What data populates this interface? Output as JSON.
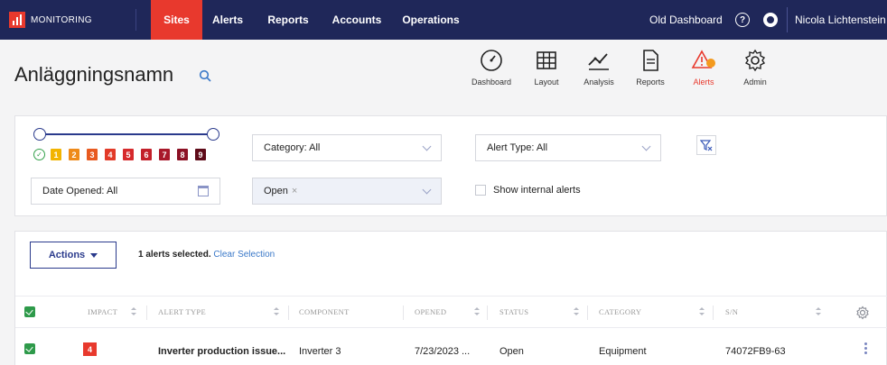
{
  "app": {
    "logo_text": "MONITORING"
  },
  "nav": {
    "items": [
      {
        "label": "Sites",
        "active": true
      },
      {
        "label": "Alerts"
      },
      {
        "label": "Reports"
      },
      {
        "label": "Accounts"
      },
      {
        "label": "Operations"
      }
    ],
    "old_dashboard": "Old Dashboard",
    "user_name": "Nicola Lichtenstein",
    "icons": [
      "help-icon",
      "support-icon"
    ]
  },
  "header": {
    "title": "Anläggningsnamn",
    "tools": [
      {
        "label": "Dashboard",
        "icon": "dashboard-icon"
      },
      {
        "label": "Layout",
        "icon": "grid-icon"
      },
      {
        "label": "Analysis",
        "icon": "chart-line-icon"
      },
      {
        "label": "Reports",
        "icon": "document-icon"
      },
      {
        "label": "Alerts",
        "icon": "alert-icon",
        "active": true
      },
      {
        "label": "Admin",
        "icon": "gear-icon"
      }
    ]
  },
  "filters": {
    "severity_levels": [
      "1",
      "2",
      "3",
      "4",
      "5",
      "6",
      "7",
      "8",
      "9"
    ],
    "severity_colors": [
      "#f2b400",
      "#ee8a1a",
      "#e85a20",
      "#e23a28",
      "#d62a2c",
      "#c3202a",
      "#a8182a",
      "#8c1024",
      "#5e0a18"
    ],
    "category": "Category: All",
    "alert_type": "Alert Type: All",
    "date_opened": "Date Opened: All",
    "status_chip": "Open",
    "show_internal": "Show internal alerts"
  },
  "table": {
    "actions_label": "Actions",
    "selection_text": "1 alerts selected.",
    "clear_selection": "Clear Selection",
    "columns": [
      "IMPACT",
      "ALERT TYPE",
      "COMPONENT",
      "OPENED",
      "STATUS",
      "CATEGORY",
      "S/N"
    ],
    "rows": [
      {
        "impact": "4",
        "alert_type": "Inverter production issue...",
        "component": "Inverter 3",
        "opened": "7/23/2023 ...",
        "status": "Open",
        "category": "Equipment",
        "sn": "74072FB9-63"
      }
    ]
  }
}
